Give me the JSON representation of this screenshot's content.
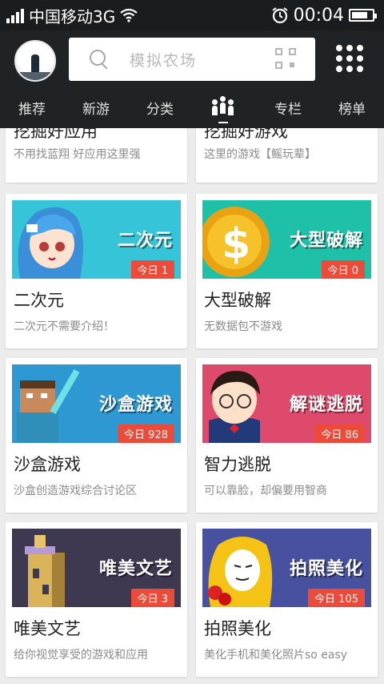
{
  "status": {
    "carrier": "中国移动3G",
    "time": "00:04"
  },
  "search": {
    "placeholder": "模拟农场"
  },
  "tabs": [
    "推荐",
    "新游",
    "分类",
    "专栏",
    "榜单"
  ],
  "top_cards": [
    {
      "title": "挖掘好应用",
      "subtitle": "不用找蓝翔 好应用这里强"
    },
    {
      "title": "挖掘好游戏",
      "subtitle": "这里的游戏【鳐玩辈】"
    }
  ],
  "cards": [
    {
      "banner_text": "二次元",
      "badge": "今日 1",
      "title": "二次元",
      "subtitle": "二次元不需要介绍！",
      "color": "#33c3d6"
    },
    {
      "banner_text": "大型破解",
      "badge": "今日 0",
      "title": "大型破解",
      "subtitle": "无数据包不游戏",
      "color": "#1fbfa6"
    },
    {
      "banner_text": "沙盒游戏",
      "badge": "今日 928",
      "title": "沙盒游戏",
      "subtitle": "沙盒创造游戏综合讨论区",
      "color": "#2c97d0"
    },
    {
      "banner_text": "解谜逃脱",
      "badge": "今日 86",
      "title": "智力逃脱",
      "subtitle": "可以靠脸，却偏要用智商",
      "color": "#de4a6a"
    },
    {
      "banner_text": "唯美文艺",
      "badge": "今日 3",
      "title": "唯美文艺",
      "subtitle": "给你视觉享受的游戏和应用",
      "color": "#3e3850"
    },
    {
      "banner_text": "拍照美化",
      "badge": "今日 105",
      "title": "拍照美化",
      "subtitle": "美化手机和美化照片so easy",
      "color": "#48509e"
    }
  ],
  "icons": [
    "signal-icon",
    "wifi-icon",
    "alarm-icon",
    "battery-icon",
    "search-icon",
    "qr-scan-icon",
    "grid-menu-icon",
    "people-icon"
  ]
}
